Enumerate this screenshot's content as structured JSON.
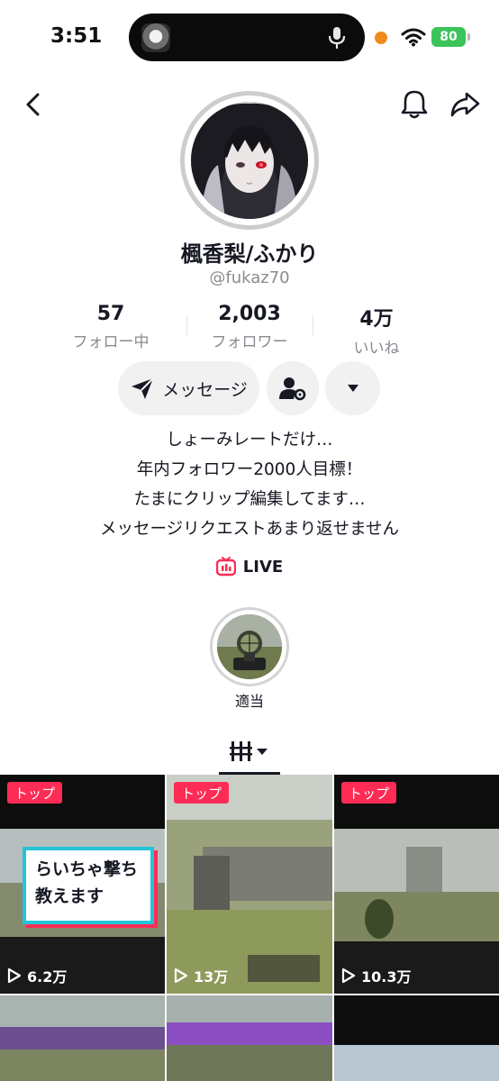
{
  "status_bar": {
    "time": "3:51",
    "battery": "80"
  },
  "profile": {
    "display_name": "楓香梨/ふかり",
    "handle": "@fukaz70"
  },
  "stats": [
    {
      "value": "57",
      "label": "フォロー中"
    },
    {
      "value": "2,003",
      "label": "フォロワー"
    },
    {
      "value": "4万",
      "label": "いいね"
    }
  ],
  "actions": {
    "message_label": "メッセージ"
  },
  "bio": [
    "しょーみレートだけ…",
    "年内フォロワー2000人目標！",
    "たまにクリップ編集してます…",
    "メッセージリクエストあまり返せません"
  ],
  "live": {
    "label": "LIVE"
  },
  "highlight": {
    "label": "適当"
  },
  "videos": [
    {
      "badge": "トップ",
      "views": "6.2万",
      "overlay": [
        "らいちゃ撃ち",
        "教えます"
      ]
    },
    {
      "badge": "トップ",
      "views": "13万"
    },
    {
      "badge": "トップ",
      "views": "10.3万"
    }
  ],
  "colors": {
    "accent": "#fe2c55",
    "battery": "#3ac45a",
    "text": "#161823",
    "muted": "#8a8b91"
  }
}
